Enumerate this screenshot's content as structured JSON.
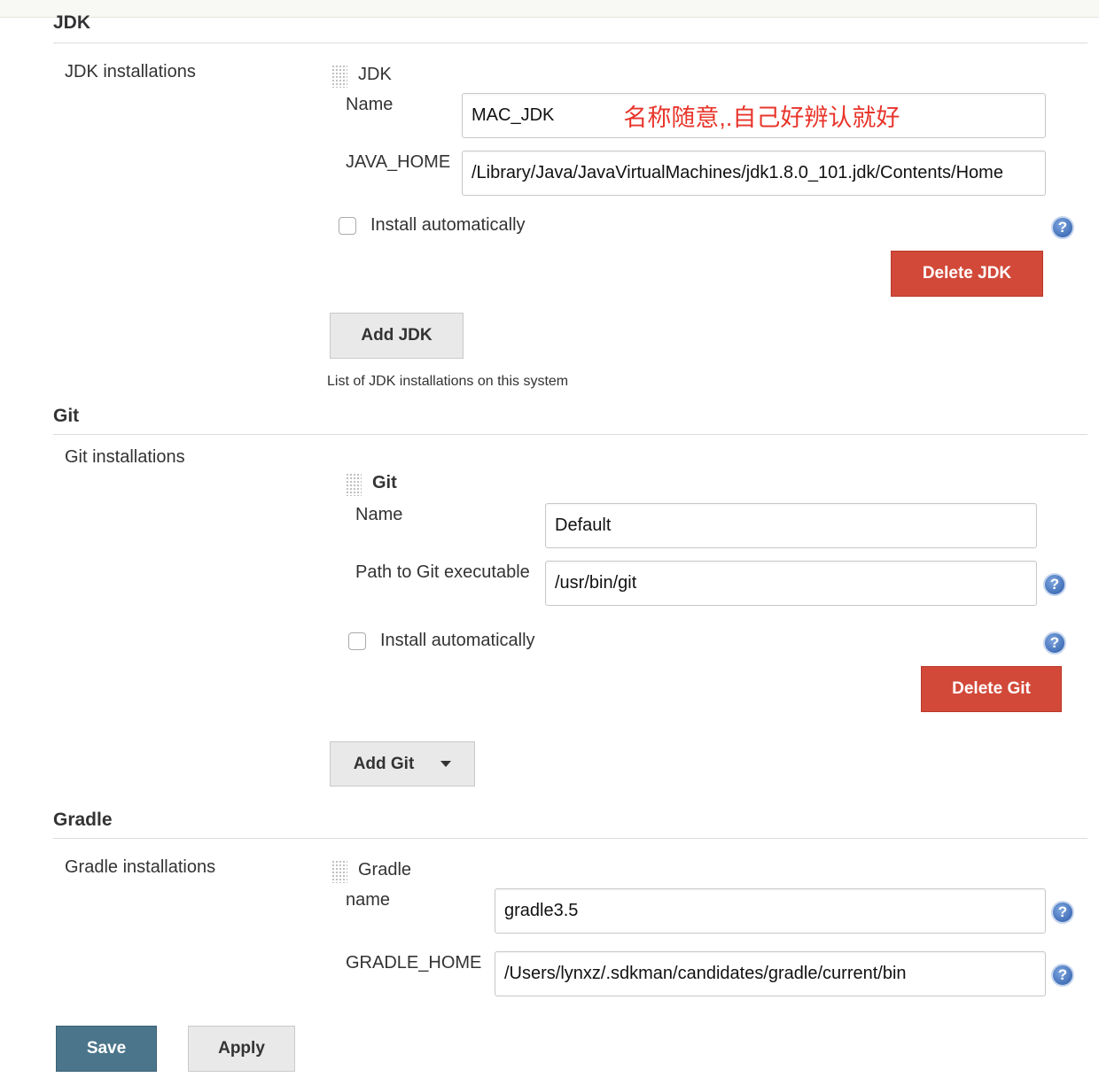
{
  "jdk": {
    "section_title": "JDK",
    "installations_label": "JDK installations",
    "item_header": "JDK",
    "name_label": "Name",
    "name_value": "MAC_JDK",
    "name_annotation": "名称随意,.自己好辨认就好",
    "home_label": "JAVA_HOME",
    "home_value": "/Library/Java/JavaVirtualMachines/jdk1.8.0_101.jdk/Contents/Home",
    "install_auto_label": "Install automatically",
    "delete_label": "Delete JDK",
    "add_label": "Add JDK",
    "description": "List of JDK installations on this system"
  },
  "git": {
    "section_title": "Git",
    "installations_label": "Git installations",
    "item_header": "Git",
    "name_label": "Name",
    "name_value": "Default",
    "path_label": "Path to Git executable",
    "path_value": "/usr/bin/git",
    "install_auto_label": "Install automatically",
    "delete_label": "Delete Git",
    "add_label": "Add Git"
  },
  "gradle": {
    "section_title": "Gradle",
    "installations_label": "Gradle installations",
    "item_header": "Gradle",
    "name_label": "name",
    "name_value": "gradle3.5",
    "home_label": "GRADLE_HOME",
    "home_value": "/Users/lynxz/.sdkman/candidates/gradle/current/bin"
  },
  "footer": {
    "save_label": "Save",
    "apply_label": "Apply"
  },
  "icons": {
    "help": "help-icon",
    "drag": "drag-handle-icon",
    "dropdown": "caret-down-icon"
  },
  "colors": {
    "danger": "#d24939",
    "primary": "#4b758b",
    "annotation": "#e8352b"
  }
}
